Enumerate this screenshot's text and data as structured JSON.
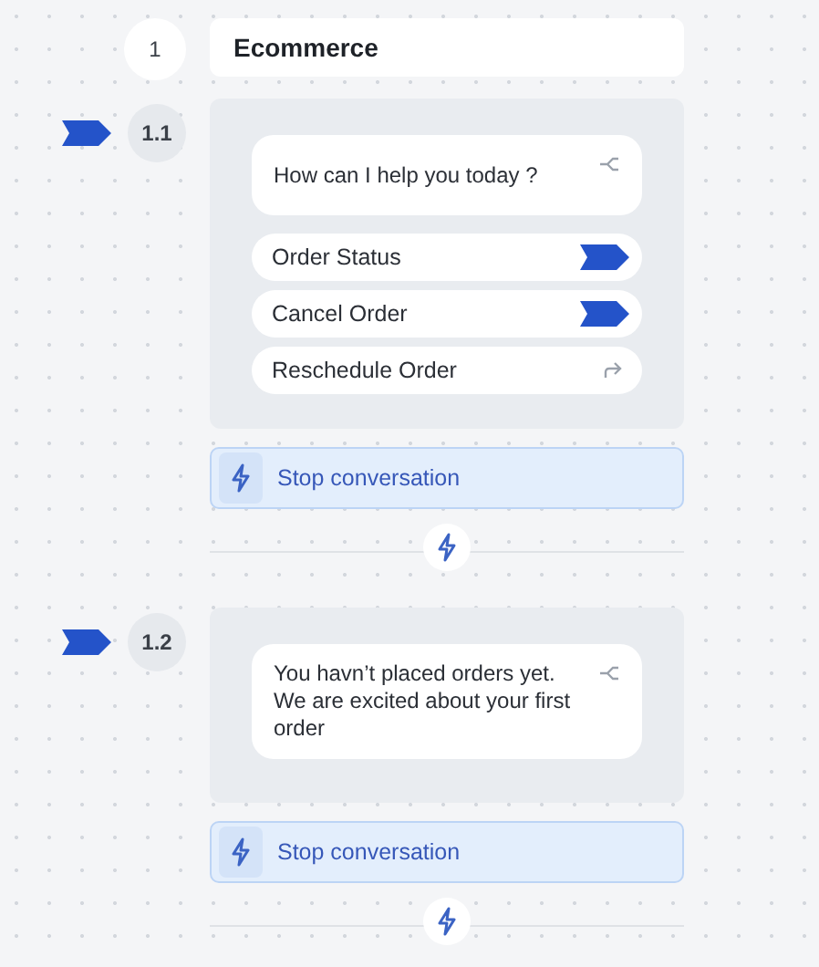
{
  "flow": {
    "number": "1",
    "title": "Ecommerce"
  },
  "steps": [
    {
      "number": "1.1",
      "flagged": true,
      "message": "How can I help you today ?",
      "options": [
        {
          "label": "Order Status",
          "kind": "branch"
        },
        {
          "label": "Cancel Order",
          "kind": "branch"
        },
        {
          "label": "Reschedule Order",
          "kind": "redirect"
        }
      ],
      "action": "Stop conversation"
    },
    {
      "number": "1.2",
      "flagged": true,
      "message": "You havn’t placed orders yet. We are excited about your first order",
      "action": "Stop conversation"
    }
  ]
}
